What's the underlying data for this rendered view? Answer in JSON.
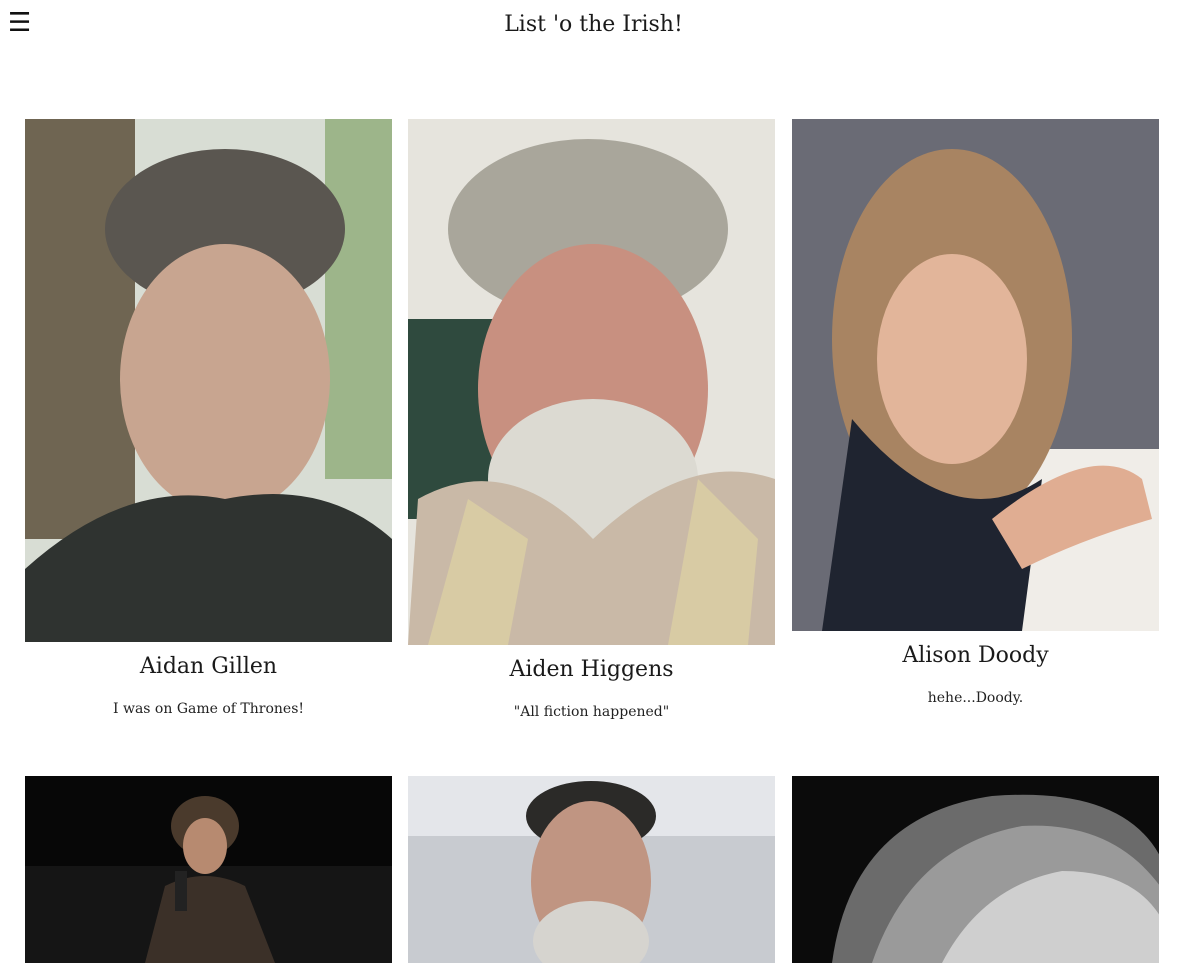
{
  "header": {
    "menu_icon": "☰",
    "title": "List 'o the Irish!"
  },
  "people": [
    {
      "name": "Aidan Gillen",
      "quote": "I was on Game of Thrones!"
    },
    {
      "name": "Aiden Higgens",
      "quote": "\"All fiction happened\""
    },
    {
      "name": "Alison Doody",
      "quote": "hehe...Doody."
    },
    {
      "name": "",
      "quote": ""
    },
    {
      "name": "",
      "quote": ""
    },
    {
      "name": "",
      "quote": ""
    }
  ],
  "colors": {
    "text": "#1a1a1a",
    "background": "#ffffff"
  }
}
